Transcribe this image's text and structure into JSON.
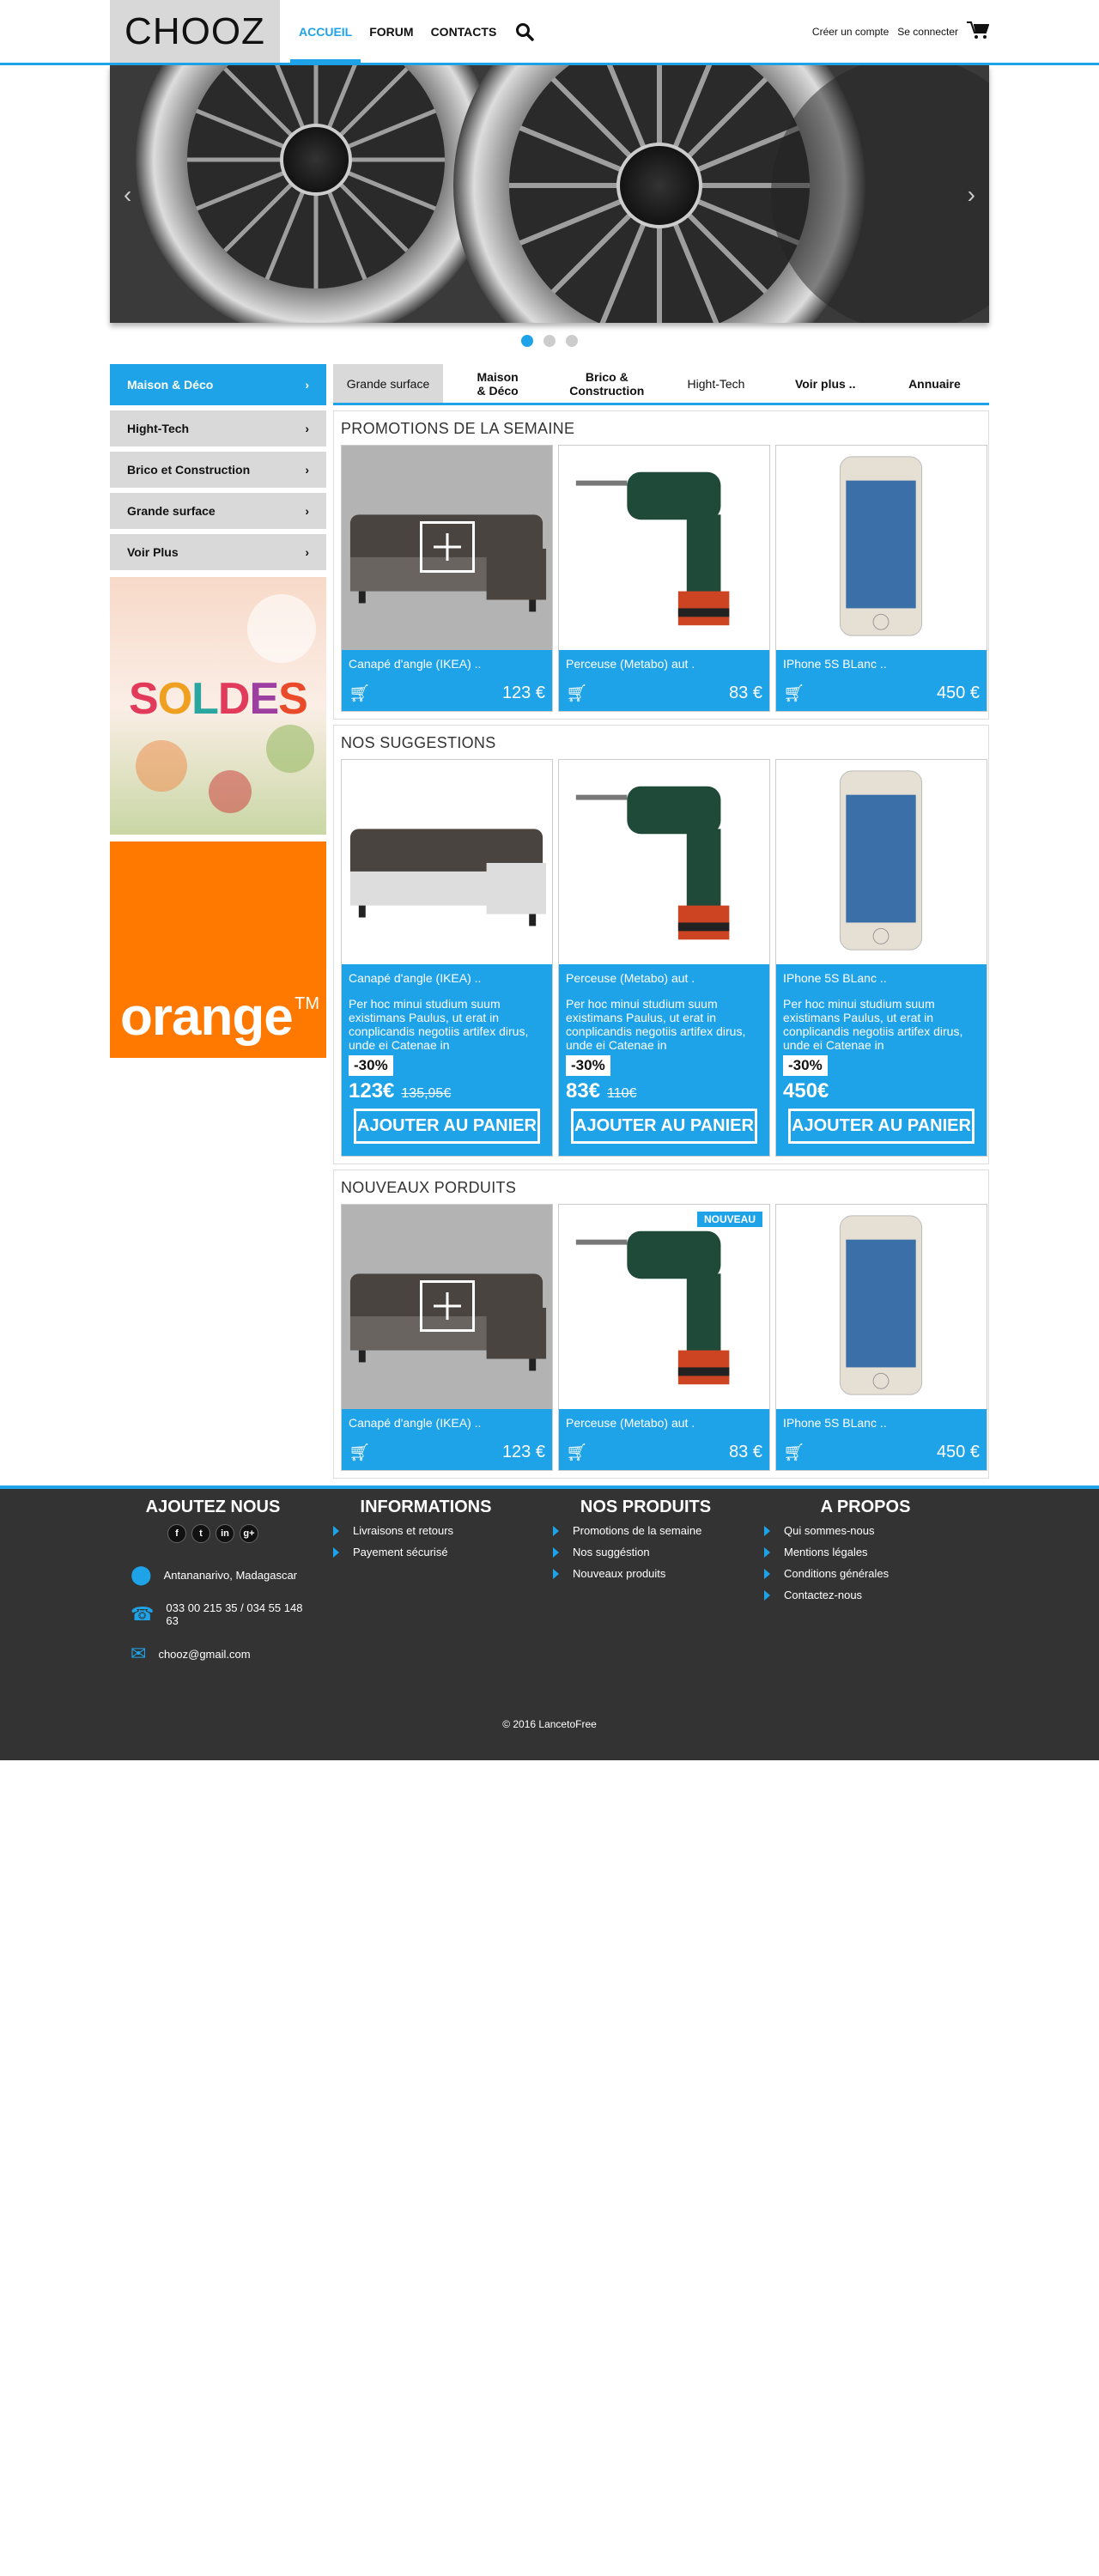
{
  "brand": {
    "logo_text": "CHOOZ"
  },
  "nav": {
    "items": [
      "ACCUEIL",
      "FORUM",
      "CONTACTS"
    ]
  },
  "account": {
    "create": "Créer un compte",
    "login": "Se connecter"
  },
  "sidebar": {
    "categories": [
      "Maison & Déco",
      "Hight-Tech",
      "Brico et Construction",
      "Grande surface",
      "Voir Plus"
    ],
    "ad_soldes": "SOLDES",
    "ad_orange": "orange",
    "ad_orange_tm": "TM"
  },
  "tabs": [
    "Grande surface",
    "Maison & Déco",
    "Brico & Construction",
    "Hight-Tech",
    "Voir plus ..",
    "Annuaire"
  ],
  "promotions": {
    "title": "PROMOTIONS DE LA SEMAINE",
    "products": [
      {
        "name": "Canapé d'angle (IKEA) ..",
        "price": "123 €"
      },
      {
        "name": "Perceuse (Metabo) aut .",
        "price": "83 €"
      },
      {
        "name": "IPhone 5S BLanc ..",
        "price": "450 €"
      }
    ]
  },
  "suggestions": {
    "title": "NOS SUGGESTIONS",
    "desc": "Per hoc minui studium suum existimans Paulus, ut erat in conplicandis negotiis artifex dirus, unde ei Catenae in",
    "button": "AJOUTER AU PANIER",
    "products": [
      {
        "name": "Canapé d'angle (IKEA) ..",
        "discount": "-30%",
        "price": "123€",
        "old": "135,95€"
      },
      {
        "name": "Perceuse (Metabo) aut .",
        "discount": "-30%",
        "price": "83€",
        "old": "110€"
      },
      {
        "name": "IPhone 5S BLanc ..",
        "discount": "-30%",
        "price": "450€",
        "old": ""
      }
    ]
  },
  "nouveaux": {
    "title": "NOUVEAUX PORDUITS",
    "badge": "NOUVEAU",
    "products": [
      {
        "name": "Canapé d'angle (IKEA) ..",
        "price": "123 €"
      },
      {
        "name": "Perceuse (Metabo) aut .",
        "price": "83 €"
      },
      {
        "name": "IPhone 5S BLanc ..",
        "price": "450 €"
      }
    ]
  },
  "footer": {
    "ajoutez": "AJOUTEZ NOUS",
    "social": [
      "f",
      "t",
      "in",
      "g+"
    ],
    "address": "Antananarivo, Madagascar",
    "phone": "033 00 215 35 / 034 55 148 63",
    "email": "chooz@gmail.com",
    "informations": {
      "title": "INFORMATIONS",
      "items": [
        "Livraisons et retours",
        "Payement sécurisé"
      ]
    },
    "produits": {
      "title": "NOS PRODUITS",
      "items": [
        "Promotions de la semaine",
        "Nos suggéstion",
        "Nouveaux produits"
      ]
    },
    "apropos": {
      "title": "A PROPOS",
      "items": [
        "Qui sommes-nous",
        "Mentions légales",
        "Conditions générales",
        "Contactez-nous"
      ]
    },
    "copyright": "© 2016 LancetoFree"
  },
  "colors": {
    "accent": "#1fa3e8",
    "footer_bg": "#333333",
    "orange": "#ff7800"
  }
}
